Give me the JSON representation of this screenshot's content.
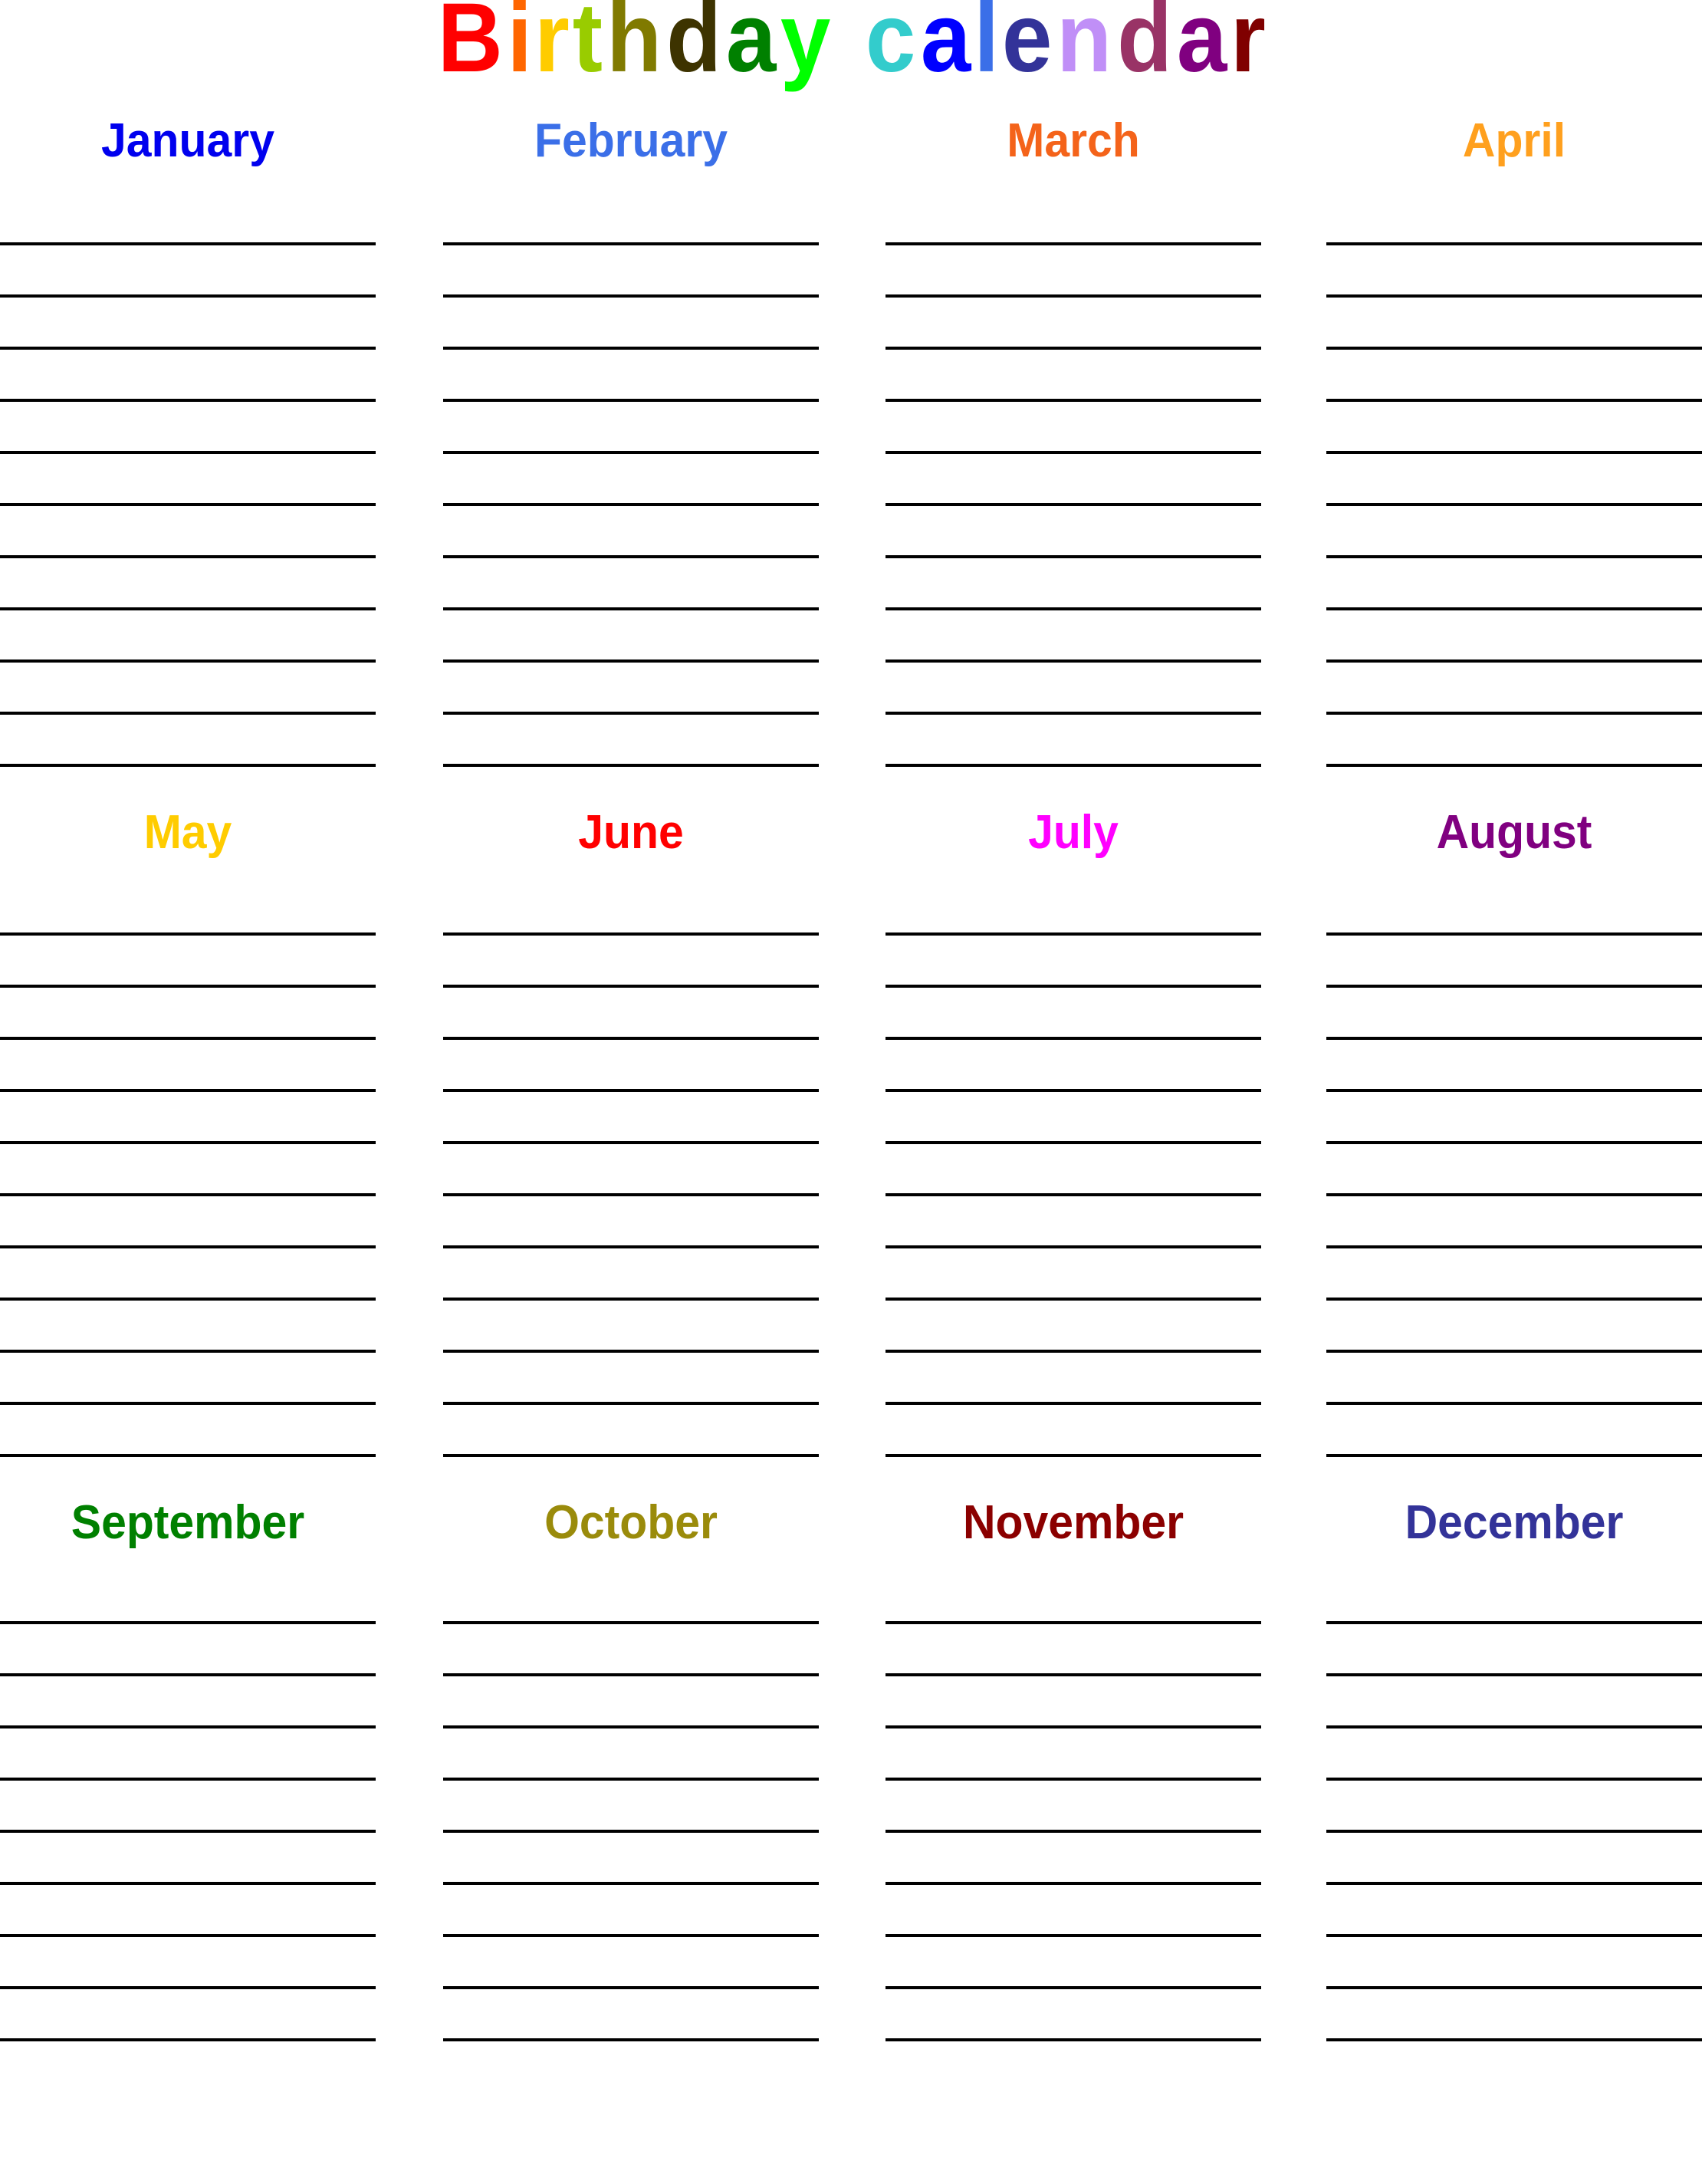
{
  "page": {
    "background_color": "#FFFFFF",
    "line_color": "#000000",
    "lines_per_month": 11
  },
  "title": {
    "text": "Birthday calendar",
    "letters": [
      {
        "char": "B",
        "color": "#FF0000"
      },
      {
        "char": "i",
        "color": "#FF6600"
      },
      {
        "char": "r",
        "color": "#FFCC00"
      },
      {
        "char": "t",
        "color": "#99CC00"
      },
      {
        "char": "h",
        "color": "#807A00"
      },
      {
        "char": "d",
        "color": "#3D3300"
      },
      {
        "char": "a",
        "color": "#008000"
      },
      {
        "char": "y",
        "color": "#00FF00"
      },
      {
        "char": " ",
        "color": "transparent"
      },
      {
        "char": "c",
        "color": "#33CCCC"
      },
      {
        "char": "a",
        "color": "#0000FF"
      },
      {
        "char": "l",
        "color": "#3B6FE8"
      },
      {
        "char": "e",
        "color": "#333399"
      },
      {
        "char": "n",
        "color": "#C08FF7"
      },
      {
        "char": "d",
        "color": "#993366"
      },
      {
        "char": "a",
        "color": "#800080"
      },
      {
        "char": "r",
        "color": "#800000"
      }
    ]
  },
  "months": [
    {
      "name": "January",
      "color": "#0000EE",
      "column": 1,
      "row": 1,
      "lines": 11
    },
    {
      "name": "February",
      "color": "#3B6FE8",
      "column": 2,
      "row": 1,
      "lines": 11
    },
    {
      "name": "March",
      "color": "#F4631A",
      "column": 3,
      "row": 1,
      "lines": 11
    },
    {
      "name": "April",
      "color": "#FFA01E",
      "column": 4,
      "row": 1,
      "lines": 11
    },
    {
      "name": "May",
      "color": "#FFCC00",
      "column": 1,
      "row": 2,
      "lines": 11
    },
    {
      "name": "June",
      "color": "#FF0000",
      "column": 2,
      "row": 2,
      "lines": 11
    },
    {
      "name": "July",
      "color": "#FF00FF",
      "column": 3,
      "row": 2,
      "lines": 11
    },
    {
      "name": "August",
      "color": "#800080",
      "column": 4,
      "row": 2,
      "lines": 11
    },
    {
      "name": "September",
      "color": "#008000",
      "column": 1,
      "row": 3,
      "lines": 9
    },
    {
      "name": "October",
      "color": "#9A8B0B",
      "column": 2,
      "row": 3,
      "lines": 9
    },
    {
      "name": "November",
      "color": "#8B0000",
      "column": 3,
      "row": 3,
      "lines": 9
    },
    {
      "name": "December",
      "color": "#333399",
      "column": 4,
      "row": 3,
      "lines": 9
    }
  ]
}
